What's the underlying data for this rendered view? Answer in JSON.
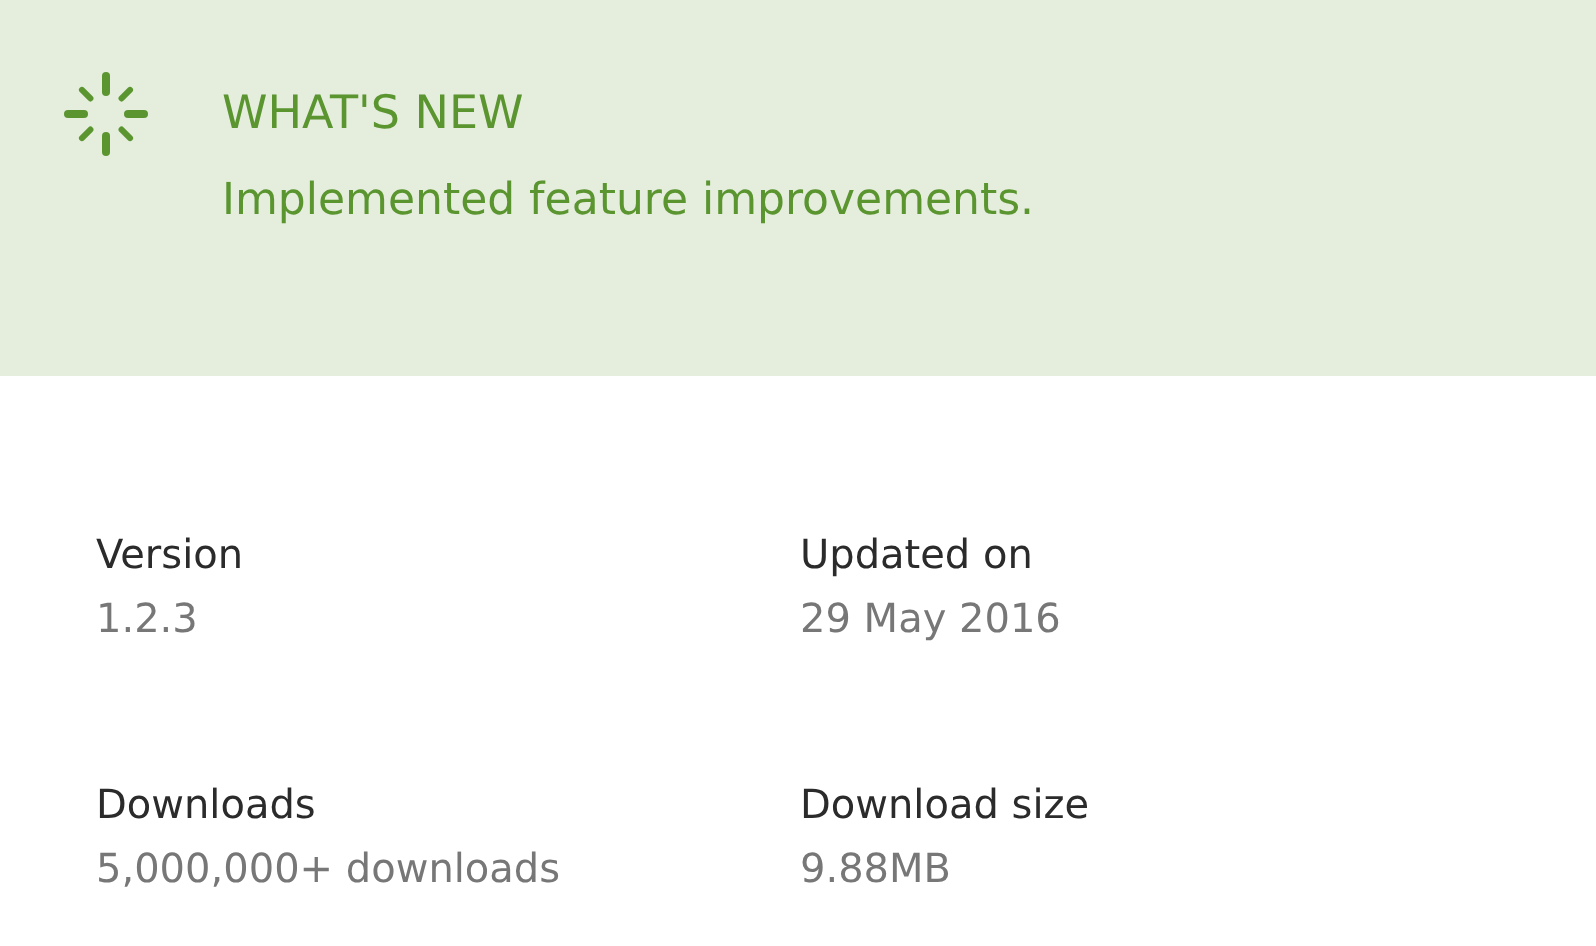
{
  "whats_new": {
    "title": "WHAT'S NEW",
    "text": "Implemented feature improvements."
  },
  "details": [
    {
      "label": "Version",
      "value": "1.2.3"
    },
    {
      "label": "Updated on",
      "value": "29 May 2016"
    },
    {
      "label": "Downloads",
      "value": "5,000,000+ downloads"
    },
    {
      "label": "Download size",
      "value": "9.88MB"
    }
  ]
}
